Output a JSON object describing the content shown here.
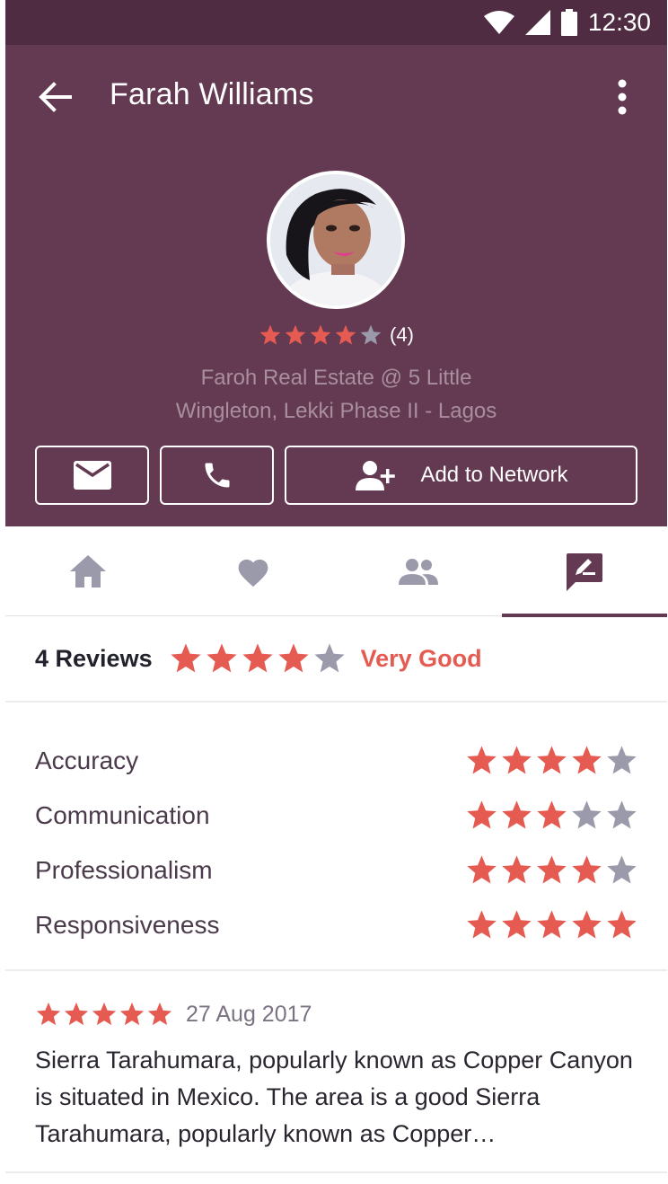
{
  "status_bar": {
    "time": "12:30",
    "icons": [
      "wifi-icon",
      "signal-icon",
      "battery-icon"
    ]
  },
  "header": {
    "title": "Farah Williams",
    "back_icon": "arrow-left-icon",
    "menu_icon": "more-vertical-icon",
    "rating": {
      "stars": 4,
      "max": 5,
      "count_label": "(4)"
    },
    "company_line1": "Faroh Real Estate @ 5 Little",
    "company_line2": "Wingleton, Lekki Phase II - Lagos",
    "actions": {
      "mail_icon": "mail-icon",
      "phone_icon": "phone-icon",
      "network_icon": "add-person-icon",
      "network_label": "Add to Network"
    }
  },
  "tabs": [
    {
      "icon": "home-icon",
      "active": false
    },
    {
      "icon": "heart-icon",
      "active": false
    },
    {
      "icon": "people-icon",
      "active": false
    },
    {
      "icon": "review-icon",
      "active": true
    }
  ],
  "summary": {
    "count_label": "4 Reviews",
    "stars": 4,
    "verdict": "Very Good"
  },
  "criteria": [
    {
      "label": "Accuracy",
      "stars": 4
    },
    {
      "label": "Communication",
      "stars": 3
    },
    {
      "label": "Professionalism",
      "stars": 4
    },
    {
      "label": "Responsiveness",
      "stars": 5
    }
  ],
  "review": {
    "stars": 5,
    "date": "27 Aug 2017",
    "text": "Sierra Tarahumara, popularly known as Copper Canyon is situated in Mexico. The area is a good Sierra Tarahumara, popularly known as Copper…"
  },
  "colors": {
    "header": "#633a51",
    "status_bar": "#4f2c41",
    "star_filled": "#e55b52",
    "star_empty": "#9a9aab",
    "tab_icon": "#9a9aab",
    "accent": "#633a51"
  }
}
